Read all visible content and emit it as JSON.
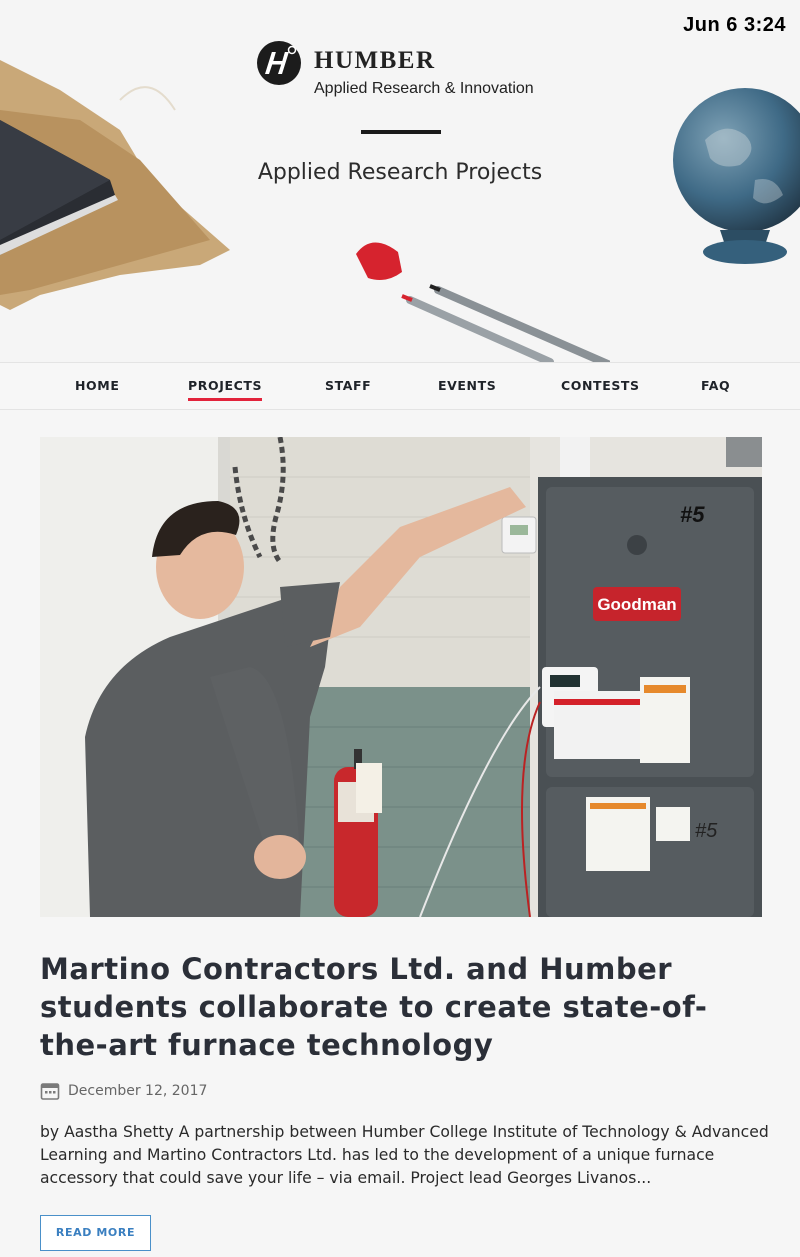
{
  "status": {
    "time": "Jun 6  3:24"
  },
  "brand": {
    "name": "HUMBER",
    "subtitle": "Applied Research & Innovation"
  },
  "hero": {
    "title": "Applied Research Projects"
  },
  "nav": {
    "items": [
      {
        "label": "HOME",
        "active": false
      },
      {
        "label": "PROJECTS",
        "active": true
      },
      {
        "label": "STAFF",
        "active": false
      },
      {
        "label": "EVENTS",
        "active": false
      },
      {
        "label": "CONTESTS",
        "active": false
      },
      {
        "label": "FAQ",
        "active": false
      }
    ]
  },
  "article": {
    "title": "Martino Contractors Ltd. and Humber students collaborate to create state-of-the-art furnace technology",
    "date": "December 12, 2017",
    "excerpt": "by Aastha Shetty A partnership between Humber College Institute of Technology & Advanced Learning and Martino Contractors Ltd. has led to the development of a unique furnace accessory that could save your life – via email. Project lead Georges Livanos...",
    "read_more": "READ MORE",
    "photo_text": {
      "furnace_brand": "Goodman",
      "unit_number": "#5",
      "unit_number_lower": "#5"
    }
  },
  "colors": {
    "accent_red": "#e2233b",
    "link_blue": "#3a7fc0",
    "furnace_gray": "#4a5054"
  }
}
